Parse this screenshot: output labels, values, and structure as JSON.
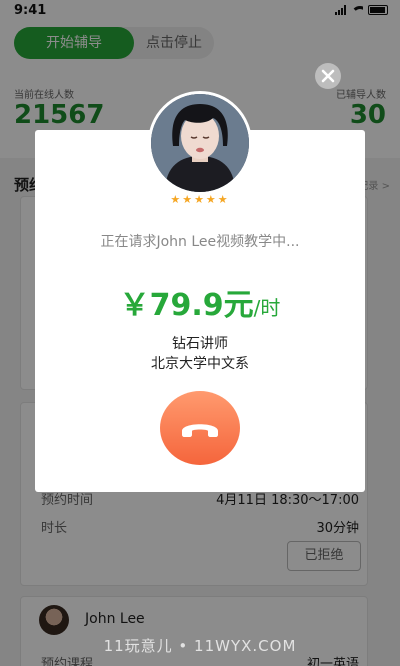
{
  "status_bar": {
    "time": "9:41"
  },
  "toggle": {
    "on_label": "开始辅导",
    "off_label": "点击停止"
  },
  "stats": {
    "online_label": "当前在线人数",
    "online_value": "21567",
    "tutored_label": "已辅导人数",
    "tutored_value": "30"
  },
  "section": {
    "title": "预约",
    "link": "记录 >"
  },
  "card2": {
    "rows": [
      {
        "label": "预约时间",
        "value": "4月11日  18:30～17:00"
      },
      {
        "label": "时长",
        "value": "30分钟"
      }
    ],
    "reject_label": "已拒绝"
  },
  "card3": {
    "name": "John Lee",
    "label": "预约课程",
    "value": "初一英语"
  },
  "modal": {
    "request_text": "正在请求John Lee视频教学中...",
    "price": "￥79.9元",
    "price_unit": "/时",
    "rating_stars": 5,
    "stars_text": "★★★★★",
    "tutor_level": "钻石讲师",
    "tutor_school": "北京大学中文系",
    "close_icon": "close-icon",
    "hangup_icon": "phone-hangup-icon"
  },
  "watermark": "11玩意儿 • 11WYX.COM",
  "colors": {
    "accent": "#27a83a",
    "hangup": "#f5653c",
    "star": "#f5a623"
  }
}
